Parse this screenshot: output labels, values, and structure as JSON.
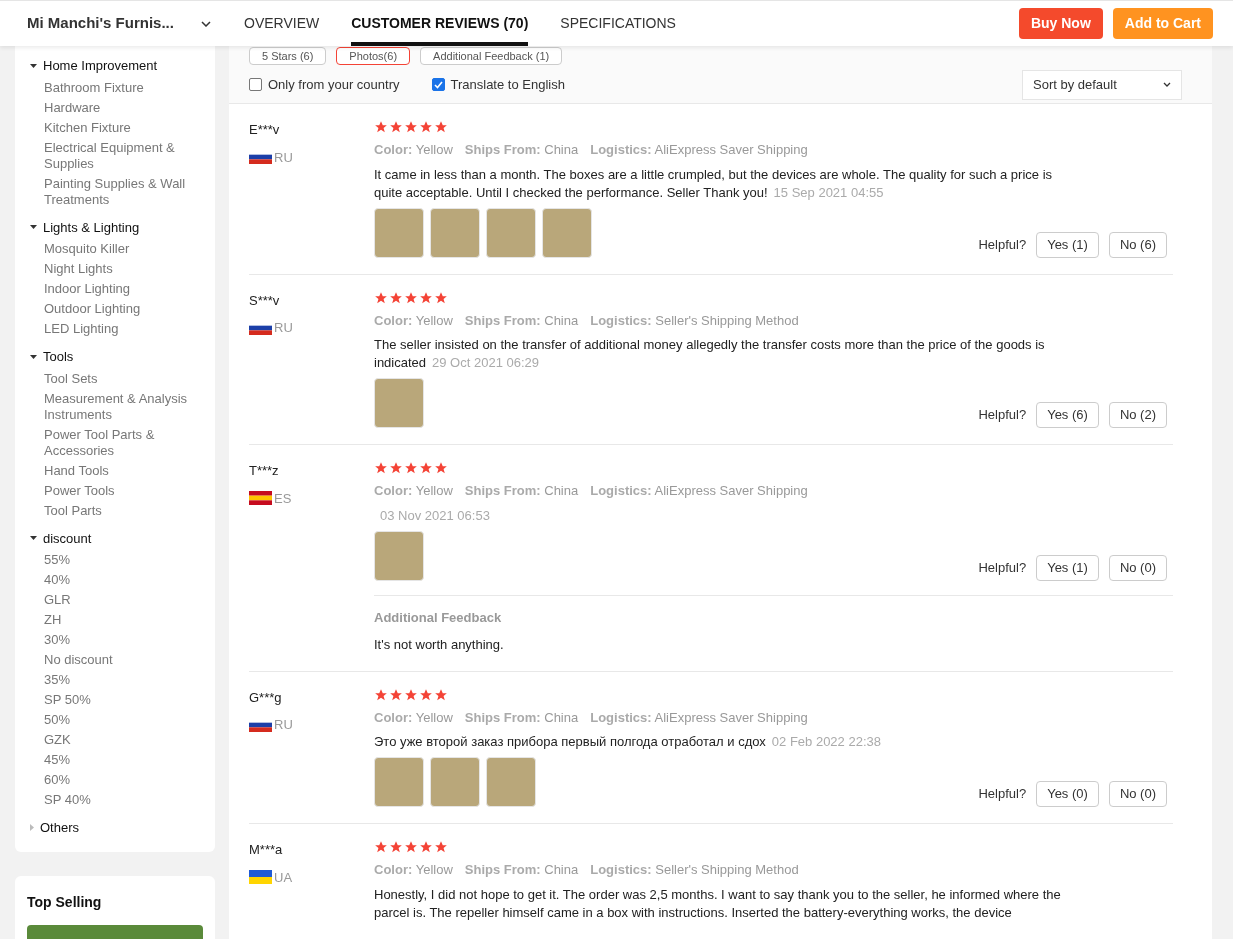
{
  "store": {
    "name": "Mi Manchi's Furnis..."
  },
  "tabs": [
    {
      "label": "OVERVIEW",
      "selected": false
    },
    {
      "label": "CUSTOMER REVIEWS (70)",
      "selected": true
    },
    {
      "label": "SPECIFICATIONS",
      "selected": false
    }
  ],
  "actions": [
    {
      "label": "Buy Now",
      "kind": "buy"
    },
    {
      "label": "Add to Cart",
      "kind": "cart"
    }
  ],
  "categories": [
    {
      "label": "Home Improvement",
      "expanded": true,
      "children": [
        {
          "label": "Bathroom Fixture"
        },
        {
          "label": "Hardware"
        },
        {
          "label": "Kitchen Fixture"
        },
        {
          "label": "Electrical Equipment & Supplies"
        },
        {
          "label": "Painting Supplies & Wall Treatments"
        }
      ]
    },
    {
      "label": "Lights & Lighting",
      "expanded": true,
      "children": [
        {
          "label": "Mosquito Killer"
        },
        {
          "label": "Night Lights"
        },
        {
          "label": "Indoor Lighting"
        },
        {
          "label": "Outdoor Lighting"
        },
        {
          "label": "LED Lighting"
        }
      ]
    },
    {
      "label": "Tools",
      "expanded": true,
      "children": [
        {
          "label": "Tool Sets"
        },
        {
          "label": "Measurement & Analysis Instruments"
        },
        {
          "label": "Power Tool Parts & Accessories"
        },
        {
          "label": "Hand Tools"
        },
        {
          "label": "Power Tools"
        },
        {
          "label": "Tool Parts"
        }
      ]
    },
    {
      "label": "discount",
      "expanded": true,
      "children": [
        {
          "label": "55%"
        },
        {
          "label": "40%"
        },
        {
          "label": "GLR"
        },
        {
          "label": "ZH"
        },
        {
          "label": "30%"
        },
        {
          "label": "No discount"
        },
        {
          "label": "35%"
        },
        {
          "label": "SP 50%"
        },
        {
          "label": "50%"
        },
        {
          "label": "GZK"
        },
        {
          "label": "45%"
        },
        {
          "label": "60%"
        },
        {
          "label": "SP 40%"
        }
      ]
    },
    {
      "label": "Others",
      "expanded": false
    }
  ],
  "top_selling": {
    "title": "Top Selling"
  },
  "filters": [
    {
      "label": "5 Stars (6)",
      "selected": false
    },
    {
      "label": "Photos(6)",
      "selected": true
    },
    {
      "label": "Additional Feedback (1)",
      "selected": false
    }
  ],
  "options": [
    {
      "label": "Only from your country",
      "checked": false
    },
    {
      "label": "Translate to English",
      "checked": true
    }
  ],
  "sort": {
    "value": "Sort by default"
  },
  "reviews": [
    {
      "name": "E***v",
      "country": "RU",
      "flag": [
        {
          "color": "#ffffff"
        },
        {
          "color": "#1c3fa8"
        },
        {
          "color": "#d52b1e"
        }
      ],
      "stars": 5,
      "attributes": [
        {
          "label": "Color:",
          "value": "Yellow"
        },
        {
          "label": "Ships From:",
          "value": "China"
        },
        {
          "label": "Logistics:",
          "value": "AliExpress Saver Shipping"
        }
      ],
      "text": "It came in less than a month. The boxes are a little crumpled, but the devices are whole. The quality for such a price is quite acceptable. Until I checked the performance. Seller Thank you!",
      "date": "15 Sep 2021 04:55",
      "photos": [
        {
          "kind": "photo"
        },
        {
          "kind": "photo"
        },
        {
          "kind": "photo"
        },
        {
          "kind": "photo"
        }
      ],
      "helpful": "Helpful?",
      "yes": "Yes (1)",
      "no": "No (6)"
    },
    {
      "name": "S***v",
      "country": "RU",
      "flag": [
        {
          "color": "#ffffff"
        },
        {
          "color": "#1c3fa8"
        },
        {
          "color": "#d52b1e"
        }
      ],
      "stars": 5,
      "attributes": [
        {
          "label": "Color:",
          "value": "Yellow"
        },
        {
          "label": "Ships From:",
          "value": "China"
        },
        {
          "label": "Logistics:",
          "value": "Seller's Shipping Method"
        }
      ],
      "text": "The seller insisted on the transfer of additional money allegedly the transfer costs more than the price of the goods is indicated",
      "date": "29 Oct 2021 06:29",
      "photos": [
        {
          "kind": "photo"
        }
      ],
      "helpful": "Helpful?",
      "yes": "Yes (6)",
      "no": "No (2)"
    },
    {
      "name": "T***z",
      "country": "ES",
      "flag": [
        {
          "color": "#c60b1e"
        },
        {
          "color": "#ffc400"
        },
        {
          "color": "#c60b1e"
        }
      ],
      "stars": 5,
      "attributes": [
        {
          "label": "Color:",
          "value": "Yellow"
        },
        {
          "label": "Ships From:",
          "value": "China"
        },
        {
          "label": "Logistics:",
          "value": "AliExpress Saver Shipping"
        }
      ],
      "date": "03 Nov 2021 06:53",
      "photos": [
        {
          "kind": "photo"
        }
      ],
      "helpful": "Helpful?",
      "yes": "Yes (1)",
      "no": "No (0)",
      "additional_feedback": {
        "title": "Additional Feedback",
        "text": "It's not worth anything."
      }
    },
    {
      "name": "G***g",
      "country": "RU",
      "flag": [
        {
          "color": "#ffffff"
        },
        {
          "color": "#1c3fa8"
        },
        {
          "color": "#d52b1e"
        }
      ],
      "stars": 5,
      "attributes": [
        {
          "label": "Color:",
          "value": "Yellow"
        },
        {
          "label": "Ships From:",
          "value": "China"
        },
        {
          "label": "Logistics:",
          "value": "AliExpress Saver Shipping"
        }
      ],
      "text": "Это уже второй заказ прибора первый полгода отработал и сдох",
      "date": "02 Feb 2022 22:38",
      "photos": [
        {
          "kind": "photo"
        },
        {
          "kind": "photo"
        },
        {
          "kind": "photo"
        }
      ],
      "helpful": "Helpful?",
      "yes": "Yes (0)",
      "no": "No (0)"
    },
    {
      "name": "M***a",
      "country": "UA",
      "flag": [
        {
          "color": "#1f5bd6"
        },
        {
          "color": "#ffd500"
        }
      ],
      "stars": 5,
      "attributes": [
        {
          "label": "Color:",
          "value": "Yellow"
        },
        {
          "label": "Ships From:",
          "value": "China"
        },
        {
          "label": "Logistics:",
          "value": "Seller's Shipping Method"
        }
      ],
      "text": "Honestly, I did not hope to get it. The order was 2,5 months. I want to say thank you to the seller, he informed where the parcel is. The repeller himself came in a box with instructions. Inserted the battery-everything works, the device"
    }
  ]
}
